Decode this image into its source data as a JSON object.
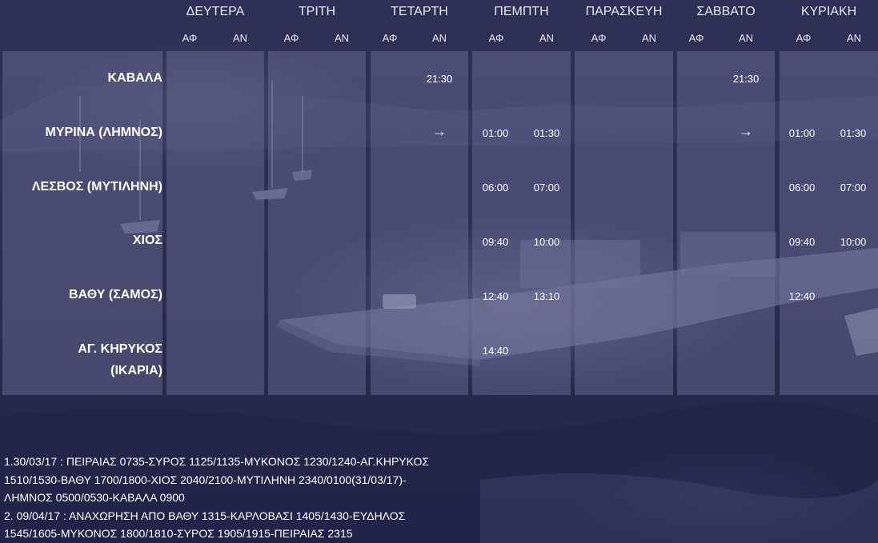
{
  "days": [
    {
      "name": "ΔΕΥΤΕΡΑ",
      "dep": "ΑΦ",
      "arr": "ΑΝ"
    },
    {
      "name": "ΤΡΙΤΗ",
      "dep": "ΑΦ",
      "arr": "ΑΝ"
    },
    {
      "name": "ΤΕΤΑΡΤΗ",
      "dep": "ΑΦ",
      "arr": "ΑΝ"
    },
    {
      "name": "ΠΕΜΠΤΗ",
      "dep": "ΑΦ",
      "arr": "ΑΝ"
    },
    {
      "name": "ΠΑΡΑΣΚΕΥΗ",
      "dep": "ΑΦ",
      "arr": "ΑΝ"
    },
    {
      "name": "ΣΑΒΒΑΤΟ",
      "dep": "ΑΦ",
      "arr": "ΑΝ"
    },
    {
      "name": "ΚΥΡΙΑΚΗ",
      "dep": "ΑΦ",
      "arr": "ΑΝ"
    }
  ],
  "ports": [
    {
      "name": "ΚΑΒΑΛΑ",
      "name2": ""
    },
    {
      "name": "ΜΥΡΙΝΑ (ΛΗΜΝΟΣ)",
      "name2": ""
    },
    {
      "name": "ΛΕΣΒΟΣ (ΜΥΤΙΛΗΝΗ)",
      "name2": ""
    },
    {
      "name": "ΧΙΟΣ",
      "name2": ""
    },
    {
      "name": "ΒΑΘΥ (ΣΑΜΟΣ)",
      "name2": ""
    },
    {
      "name": "ΑΓ. ΚΗΡΥΚΟΣ",
      "name2": "(ΙΚΑΡΙΑ)"
    }
  ],
  "times": {
    "kavala_wed_an": "21:30",
    "kavala_sat_an": "21:30",
    "myrina_wed_an": "→",
    "myrina_thu_af": "01:00",
    "myrina_thu_an": "01:30",
    "myrina_sat_an": "→",
    "myrina_sun_af": "01:00",
    "myrina_sun_an": "01:30",
    "lesvos_thu_af": "06:00",
    "lesvos_thu_an": "07:00",
    "lesvos_sun_af": "06:00",
    "lesvos_sun_an": "07:00",
    "chios_thu_af": "09:40",
    "chios_thu_an": "10:00",
    "chios_sun_af": "09:40",
    "chios_sun_an": "10:00",
    "vathy_thu_af": "12:40",
    "vathy_thu_an": "13:10",
    "vathy_sun_af": "12:40",
    "kirykos_thu_af": "14:40"
  },
  "notes": [
    "1.30/03/17 : ΠΕΙΡΑΙΑΣ 0735-ΣΥΡΟΣ 1125/1135-ΜΥΚΟΝΟΣ 1230/1240-ΑΓ.ΚΗΡΥΚΟΣ",
    "1510/1530-ΒΑΘΥ 1700/1800-ΧΙΟΣ 2040/2100-ΜΥΤΙΛΗΝΗ 2340/0100(31/03/17)-",
    "ΛΗΜΝΟΣ 0500/0530-ΚΑΒΑΛΑ 0900",
    "2. 09/04/17 : ΑΝΑΧΩΡΗΣΗ ΑΠΟ ΒΑΘΥ 1315-ΚΑΡΛΟΒΑΣΙ 1405/1430-ΕΥΔΗΛΟΣ",
    "1545/1605-ΜΥΚΟΝΟΣ 1800/1810-ΣΥΡΟΣ 1905/1915-ΠΕΙΡΑΙΑΣ 2315"
  ]
}
